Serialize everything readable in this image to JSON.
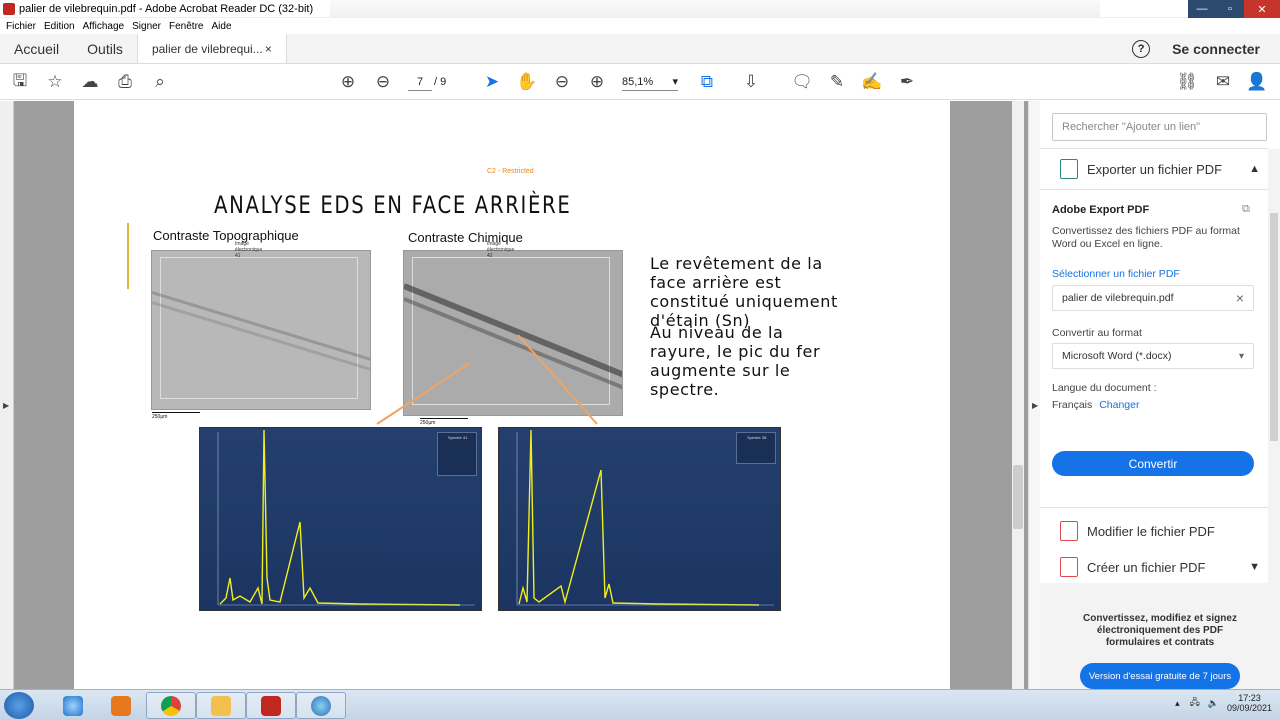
{
  "window": {
    "title": "palier de vilebrequin.pdf - Adobe Acrobat Reader DC (32-bit)"
  },
  "menu": [
    "Fichier",
    "Edition",
    "Affichage",
    "Signer",
    "Fenêtre",
    "Aide"
  ],
  "tabs": {
    "home": "Accueil",
    "tools": "Outils",
    "document": "palier de vilebrequi...",
    "close": "×",
    "help": "?",
    "signin": "Se connecter"
  },
  "toolbar": {
    "current_page": "7",
    "total_pages": "/ 9",
    "zoom": "85,1%"
  },
  "slide": {
    "restricted": "C2 - Restricted",
    "title": "ANALYSE EDS EN FACE ARRIÈRE",
    "label_topo": "Contraste Topographique",
    "label_chem": "Contraste Chimique",
    "caption_topo": "Image électronique 41",
    "caption_chem": "Image électronique 42",
    "scale_topo": "250µm",
    "scale_chem": "250µm",
    "para1": "Le revêtement de la face arrière est constitué uniquement d'étain (Sn)",
    "para2": "Au niveau de la rayure, le pic du fer augmente sur le spectre.",
    "spectrum_left_title": "Spectre 41",
    "spectrum_right_title": "Spectre 38"
  },
  "panel": {
    "search_placeholder": "Rechercher \"Ajouter un lien\"",
    "export_header": "Exporter un fichier PDF",
    "adobe_export": "Adobe Export PDF",
    "export_desc": "Convertissez des fichiers PDF au format Word ou Excel en ligne.",
    "select_file": "Sélectionner un fichier PDF",
    "file_name": "palier de vilebrequin.pdf",
    "convert_to": "Convertir au format",
    "format": "Microsoft Word (*.docx)",
    "doc_lang": "Langue du document :",
    "language": "Français",
    "change": "Changer",
    "convert_btn": "Convertir",
    "edit_pdf": "Modifier le fichier PDF",
    "create_pdf": "Créer un fichier PDF",
    "promo_text": "Convertissez, modifiez et signez électroniquement des PDF formulaires et contrats",
    "trial_btn": "Version d'essai gratuite de 7 jours"
  },
  "taskbar": {
    "time": "17:23",
    "date": "09/09/2021"
  },
  "colors": {
    "accent": "#1473e6",
    "export_icon": "#2a8a7d",
    "edit_icon": "#e34850",
    "restricted": "#e8841e"
  }
}
